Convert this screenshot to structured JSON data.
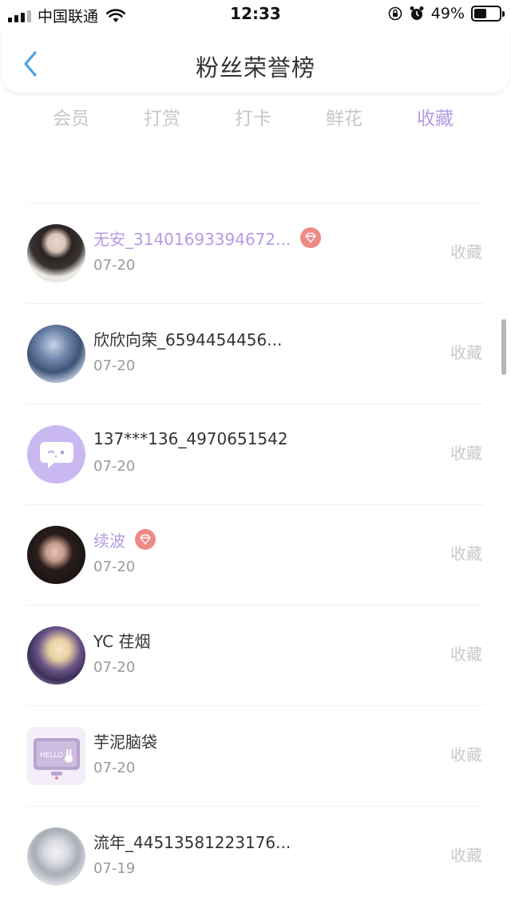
{
  "status_bar": {
    "carrier": "中国联通",
    "time": "12:33",
    "battery_percent": "49%",
    "battery_level": 0.49
  },
  "header": {
    "title": "粉丝荣誉榜",
    "back_icon": "chevron-left-icon"
  },
  "tabs": [
    {
      "label": "会员",
      "active": false
    },
    {
      "label": "打赏",
      "active": false
    },
    {
      "label": "打卡",
      "active": false
    },
    {
      "label": "鲜花",
      "active": false
    },
    {
      "label": "收藏",
      "active": true
    }
  ],
  "colors": {
    "accent": "#b59be3",
    "badge": "#ee8a86",
    "muted": "#c9c9c9"
  },
  "fans": [
    {
      "name": "",
      "date": "07-20",
      "action": "",
      "vip": false
    },
    {
      "name": "无安_31401693394672...",
      "date": "07-20",
      "action": "收藏",
      "vip": true
    },
    {
      "name": "欣欣向荣_6594454456...",
      "date": "07-20",
      "action": "收藏",
      "vip": false
    },
    {
      "name": "137***136_4970651542",
      "date": "07-20",
      "action": "收藏",
      "vip": false
    },
    {
      "name": "续波",
      "date": "07-20",
      "action": "收藏",
      "vip": true
    },
    {
      "name": "YC 荏烟",
      "date": "07-20",
      "action": "收藏",
      "vip": false
    },
    {
      "name": "芋泥脑袋",
      "date": "07-20",
      "action": "收藏",
      "vip": false
    },
    {
      "name": "流年_44513581223176...",
      "date": "07-19",
      "action": "收藏",
      "vip": false
    }
  ]
}
